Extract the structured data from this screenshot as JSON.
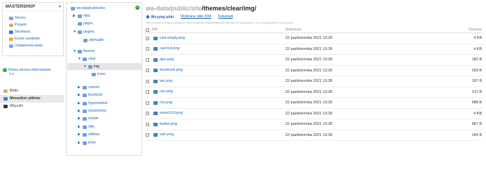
{
  "sidebar": {
    "site_title": "MASTERSHOP",
    "site_items": [
      {
        "label": "Strony",
        "icon": "page-icon",
        "color": "#8aa4c8"
      },
      {
        "label": "Projekt",
        "icon": "design-icon",
        "color": "#e8a33b"
      },
      {
        "label": "Struktura",
        "icon": "structure-icon",
        "color": "#3b7dd8"
      },
      {
        "label": "Konto osobiste",
        "icon": "key-icon",
        "color": "#e2b13c"
      },
      {
        "label": "Ustawienia www",
        "icon": "settings-icon",
        "color": "#7fa7d6"
      }
    ],
    "new_site": "Nowa strona internetowa",
    "new_site_sub": "link",
    "menu": [
      {
        "label": "Bloki",
        "icon": "blocks-icon",
        "color": "#d8b07a"
      },
      {
        "label": "Menedżer plików",
        "icon": "upload-icon",
        "color": "#3b7dd8"
      },
      {
        "label": "Wtyczki",
        "icon": "plugins-icon",
        "color": "#333333"
      }
    ]
  },
  "tree": {
    "root": "wa-data/public/site",
    "nodes": [
      "data",
      "pages",
      "plugins",
      "sitehealth",
      "themes",
      "clear",
      "img",
      "icons",
      "custom",
      "facebook",
      "hypermarket",
      "mastershop",
      "mobile",
      "nifty",
      "sidebar",
      "timer"
    ]
  },
  "main": {
    "path_prefix": "wa-data/public/site",
    "path_current": "/themes/clear/img/",
    "upload": "Wczytaj pliki",
    "selected": "Wybrane pliki (0)",
    "catalog": "Katalog",
    "hint": "Pliki przesłane tutaj są dostępne dla wszystkich odwiedzających witrynę bez autoryzacji. Nie przesyłaj plików osobistych.",
    "columns": {
      "name": "Plik",
      "date": "Zmieniono",
      "size": "Rozmiar"
    },
    "files": [
      {
        "name": "cart-empty.png",
        "date": "22 października 2021 13:28",
        "size": "4 KB"
      },
      {
        "name": "cart-full.png",
        "date": "22 października 2021 13:28",
        "size": "4 KB"
      },
      {
        "name": "darr.png",
        "date": "22 października 2021 13:28",
        "size": "182 B"
      },
      {
        "name": "facebook.png",
        "date": "22 października 2021 13:28",
        "size": "259 B"
      },
      {
        "name": "larr.png",
        "date": "22 października 2021 13:28",
        "size": "187 B"
      },
      {
        "name": "rarr.png",
        "date": "22 października 2021 13:28",
        "size": "217 B"
      },
      {
        "name": "rss.png",
        "date": "22 października 2021 13:28",
        "size": "688 B"
      },
      {
        "name": "search10.png",
        "date": "22 października 2021 13:28",
        "size": "4 KB"
      },
      {
        "name": "twitter.png",
        "date": "22 października 2021 13:28",
        "size": "687 B"
      },
      {
        "name": "uarr.png",
        "date": "22 października 2021 13:28",
        "size": "184 B"
      }
    ]
  }
}
